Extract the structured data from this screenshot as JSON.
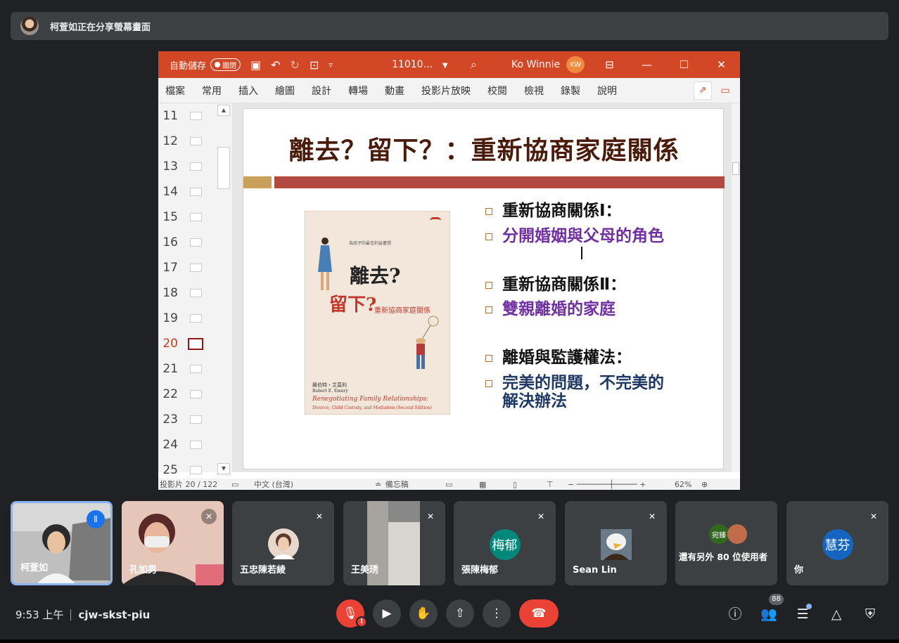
{
  "banner": {
    "text": "柯萱如正在分享螢幕畫面"
  },
  "ppt": {
    "autosave": "自動儲存",
    "autosave_state": "關閉",
    "filename": "11010...",
    "user": "Ko Winnie",
    "user_initials": "KW",
    "tabs": [
      "檔案",
      "常用",
      "插入",
      "繪圖",
      "設計",
      "轉場",
      "動畫",
      "投影片放映",
      "校閱",
      "檢視",
      "錄製",
      "說明"
    ],
    "thumbnails": [
      "11",
      "12",
      "13",
      "14",
      "15",
      "16",
      "17",
      "18",
      "19",
      "20",
      "21",
      "22",
      "23",
      "24",
      "25"
    ],
    "active_slide": "20",
    "status": {
      "slide_count": "投影片 20 / 122",
      "language": "中文 (台灣)",
      "notes": "備忘稿",
      "zoom": "62%"
    },
    "slide": {
      "title": "離去？留下？：重新協商家庭關係",
      "book": {
        "small": "為孩子的最佳利益著想",
        "title1": "離去?",
        "title2": "留下?",
        "subtitle": "重新協商家庭關係",
        "author_cn": "羅伯特・艾莫利",
        "author_en": "Robert E. Emery",
        "title_en": "Renegotiating Family Relationships:",
        "title_en2": "Divorce, Child Custody, and Mediation (Second Edition)"
      },
      "bullets": [
        {
          "text": "重新協商關係Ⅰ：",
          "style": "black"
        },
        {
          "text": "分開婚姻與父母的角色",
          "style": "purple"
        },
        {
          "text": "重新協商關係Ⅱ：",
          "style": "black"
        },
        {
          "text": "雙親離婚的家庭",
          "style": "purple"
        },
        {
          "text": "離婚與監護權法：",
          "style": "black"
        },
        {
          "text": "完美的問題，不完美的解決辦法",
          "style": "navy"
        }
      ]
    }
  },
  "participants": [
    {
      "name": "柯萱如",
      "avatar": "",
      "muted": false,
      "speaking": true
    },
    {
      "name": "孔如男",
      "avatar": "",
      "muted": true
    },
    {
      "name": "五忠陳若綾",
      "avatar": "",
      "muted": true
    },
    {
      "name": "王美琇",
      "avatar": "",
      "muted": true
    },
    {
      "name": "張陳梅郁",
      "avatar": "梅郁",
      "avatar_color": "#00897b",
      "muted": true
    },
    {
      "name": "Sean Lin",
      "avatar": "",
      "muted": true
    },
    {
      "name": "還有另外 80 位使用者",
      "avatar": "宛臻",
      "avatar_color": "#33691e"
    },
    {
      "name": "你",
      "avatar": "慧芬",
      "avatar_color": "#1565c0",
      "muted": true
    }
  ],
  "meeting": {
    "time": "9:53 上午",
    "code": "cjw-skst-piu",
    "participant_count": "88"
  },
  "colors": {
    "accent": "#d24726",
    "meet_bg": "#202124",
    "tile": "#3c4043",
    "hangup": "#ea4335"
  }
}
